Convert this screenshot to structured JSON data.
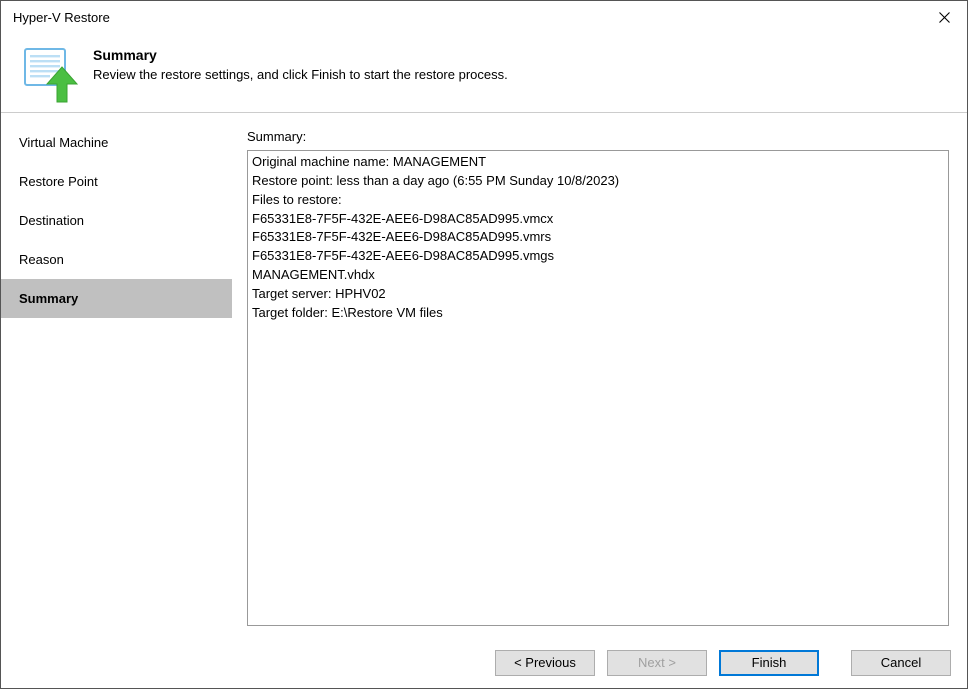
{
  "window": {
    "title": "Hyper-V Restore"
  },
  "header": {
    "title": "Summary",
    "subtitle": "Review the restore settings, and click Finish to start the restore process."
  },
  "sidebar": {
    "items": [
      {
        "label": "Virtual Machine"
      },
      {
        "label": "Restore Point"
      },
      {
        "label": "Destination"
      },
      {
        "label": "Reason"
      },
      {
        "label": "Summary"
      }
    ]
  },
  "content": {
    "label": "Summary:",
    "summary_text": "Original machine name: MANAGEMENT\nRestore point: less than a day ago (6:55 PM Sunday 10/8/2023)\nFiles to restore:\nF65331E8-7F5F-432E-AEE6-D98AC85AD995.vmcx\nF65331E8-7F5F-432E-AEE6-D98AC85AD995.vmrs\nF65331E8-7F5F-432E-AEE6-D98AC85AD995.vmgs\nMANAGEMENT.vhdx\nTarget server: HPHV02\nTarget folder: E:\\Restore VM files"
  },
  "footer": {
    "previous": "< Previous",
    "next": "Next >",
    "finish": "Finish",
    "cancel": "Cancel"
  }
}
